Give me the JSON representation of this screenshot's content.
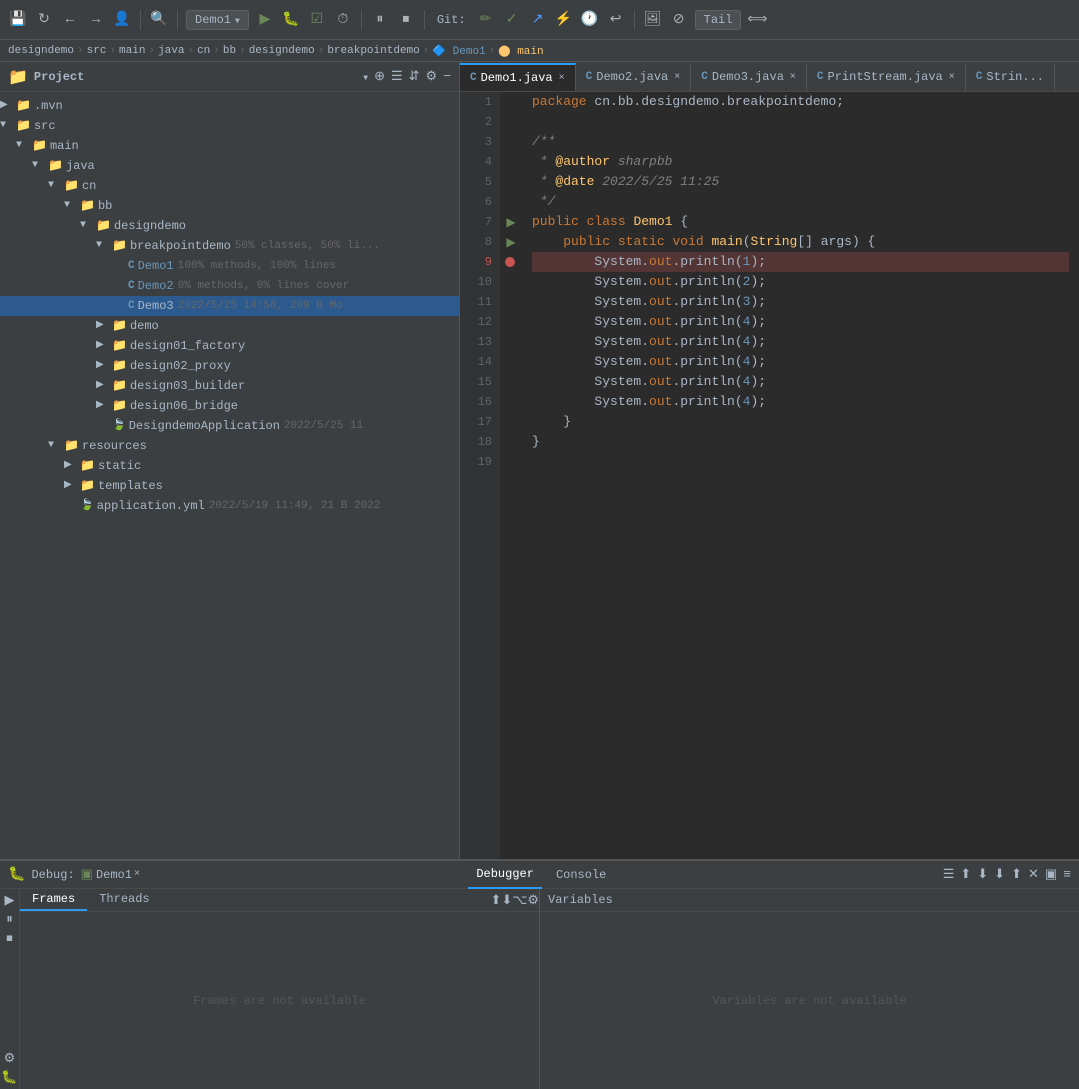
{
  "toolbar": {
    "run_config": "Demo1",
    "git_label": "Git:",
    "tail_label": "Tail",
    "translate_icon": "⟺"
  },
  "breadcrumb": {
    "items": [
      "designdemo",
      "src",
      "main",
      "java",
      "cn",
      "bb",
      "designdemo",
      "breakpointdemo",
      "Demo1",
      "main"
    ]
  },
  "project": {
    "title": "Project",
    "tree": [
      {
        "id": "mvn",
        "label": ".mvn",
        "type": "folder",
        "depth": 0,
        "open": false
      },
      {
        "id": "src",
        "label": "src",
        "type": "folder",
        "depth": 0,
        "open": true
      },
      {
        "id": "main",
        "label": "main",
        "type": "folder",
        "depth": 1,
        "open": true
      },
      {
        "id": "java",
        "label": "java",
        "type": "folder",
        "depth": 2,
        "open": true
      },
      {
        "id": "cn",
        "label": "cn",
        "type": "folder",
        "depth": 3,
        "open": true
      },
      {
        "id": "bb",
        "label": "bb",
        "type": "folder",
        "depth": 4,
        "open": true
      },
      {
        "id": "designdemo",
        "label": "designdemo",
        "type": "folder",
        "depth": 5,
        "open": true
      },
      {
        "id": "breakpointdemo",
        "label": "breakpointdemo",
        "type": "folder",
        "depth": 6,
        "open": true,
        "meta": "50% classes, 50% li..."
      },
      {
        "id": "Demo1",
        "label": "Demo1",
        "type": "java",
        "depth": 7,
        "meta": "100% methods, 100% lines"
      },
      {
        "id": "Demo2",
        "label": "Demo2",
        "type": "java",
        "depth": 7,
        "meta": "0% methods, 0% lines cover"
      },
      {
        "id": "Demo3",
        "label": "Demo3",
        "type": "java",
        "depth": 7,
        "selected": true,
        "meta": "2022/5/25 14:58, 209 B Mo"
      },
      {
        "id": "demo",
        "label": "demo",
        "type": "folder",
        "depth": 6,
        "open": false
      },
      {
        "id": "design01_factory",
        "label": "design01_factory",
        "type": "folder",
        "depth": 6,
        "open": false
      },
      {
        "id": "design02_proxy",
        "label": "design02_proxy",
        "type": "folder",
        "depth": 6,
        "open": false
      },
      {
        "id": "design03_builder",
        "label": "design03_builder",
        "type": "folder",
        "depth": 6,
        "open": false
      },
      {
        "id": "design06_bridge",
        "label": "design06_bridge",
        "type": "folder",
        "depth": 6,
        "open": false
      },
      {
        "id": "DesigndemoApplication",
        "label": "DesigndemoApplication",
        "type": "spring",
        "depth": 6,
        "meta": "2022/5/25 11"
      },
      {
        "id": "resources",
        "label": "resources",
        "type": "folder",
        "depth": 3,
        "open": true
      },
      {
        "id": "static",
        "label": "static",
        "type": "folder",
        "depth": 4,
        "open": false
      },
      {
        "id": "templates",
        "label": "templates",
        "type": "folder",
        "depth": 4,
        "open": false
      },
      {
        "id": "application_yml",
        "label": "application.yml",
        "type": "yml",
        "depth": 4,
        "meta": "2022/5/19 11:49, 21 B 2022"
      }
    ]
  },
  "editor": {
    "tabs": [
      {
        "id": "Demo1",
        "label": "Demo1.java",
        "active": true
      },
      {
        "id": "Demo2",
        "label": "Demo2.java",
        "active": false
      },
      {
        "id": "Demo3",
        "label": "Demo3.java",
        "active": false
      },
      {
        "id": "PrintStream",
        "label": "PrintStream.java",
        "active": false
      },
      {
        "id": "Strin",
        "label": "Strin...",
        "active": false
      }
    ],
    "code_lines": [
      {
        "n": 1,
        "text": "package cn.bb.designdemo.breakpointdemo;",
        "tokens": [
          {
            "t": "kw",
            "v": "package"
          },
          {
            "t": "sym",
            "v": " cn.bb.designdemo.breakpointdemo;"
          }
        ]
      },
      {
        "n": 2,
        "text": ""
      },
      {
        "n": 3,
        "text": "/**",
        "tokens": [
          {
            "t": "cm",
            "v": "/**"
          }
        ]
      },
      {
        "n": 4,
        "text": " * @author sharpbb",
        "tokens": [
          {
            "t": "cm",
            "v": " * "
          },
          {
            "t": "ann",
            "v": "@author"
          },
          {
            "t": "cm",
            "v": " sharpbb"
          }
        ]
      },
      {
        "n": 5,
        "text": " * @date 2022/5/25 11:25",
        "tokens": [
          {
            "t": "cm",
            "v": " * "
          },
          {
            "t": "ann",
            "v": "@date"
          },
          {
            "t": "cm",
            "v": " 2022/5/25 11:25"
          }
        ]
      },
      {
        "n": 6,
        "text": " */",
        "tokens": [
          {
            "t": "cm",
            "v": " */"
          }
        ]
      },
      {
        "n": 7,
        "text": "public class Demo1 {",
        "tokens": [
          {
            "t": "kw",
            "v": "public"
          },
          {
            "t": "sym",
            "v": " "
          },
          {
            "t": "kw",
            "v": "class"
          },
          {
            "t": "sym",
            "v": " "
          },
          {
            "t": "cls",
            "v": "Demo1"
          },
          {
            "t": "sym",
            "v": " {"
          }
        ],
        "run": true
      },
      {
        "n": 8,
        "text": "    public static void main(String[] args) {",
        "tokens": [
          {
            "t": "kw",
            "v": "    public"
          },
          {
            "t": "sym",
            "v": " "
          },
          {
            "t": "kw",
            "v": "static"
          },
          {
            "t": "sym",
            "v": " "
          },
          {
            "t": "kw",
            "v": "void"
          },
          {
            "t": "sym",
            "v": " "
          },
          {
            "t": "fn",
            "v": "main"
          },
          {
            "t": "sym",
            "v": "("
          },
          {
            "t": "cls",
            "v": "String"
          },
          {
            "t": "sym",
            "v": "[] args) {"
          }
        ],
        "run": true
      },
      {
        "n": 9,
        "text": "        System.out.println(1);",
        "tokens": [
          {
            "t": "sym",
            "v": "        System.out.println("
          },
          {
            "t": "num",
            "v": "1"
          },
          {
            "t": "sym",
            "v": ");"
          }
        ],
        "breakpoint": true
      },
      {
        "n": 10,
        "text": "        System.out.println(2);",
        "tokens": [
          {
            "t": "sym",
            "v": "        System.out.println("
          },
          {
            "t": "num",
            "v": "2"
          },
          {
            "t": "sym",
            "v": ");"
          }
        ]
      },
      {
        "n": 11,
        "text": "        System.out.println(3);",
        "tokens": [
          {
            "t": "sym",
            "v": "        System.out.println("
          },
          {
            "t": "num",
            "v": "3"
          },
          {
            "t": "sym",
            "v": ");"
          }
        ]
      },
      {
        "n": 12,
        "text": "        System.out.println(4);",
        "tokens": [
          {
            "t": "sym",
            "v": "        System.out.println("
          },
          {
            "t": "num",
            "v": "4"
          },
          {
            "t": "sym",
            "v": ");"
          }
        ]
      },
      {
        "n": 13,
        "text": "        System.out.println(4);",
        "tokens": [
          {
            "t": "sym",
            "v": "        System.out.println("
          },
          {
            "t": "num",
            "v": "4"
          },
          {
            "t": "sym",
            "v": ");"
          }
        ]
      },
      {
        "n": 14,
        "text": "        System.out.println(4);",
        "tokens": [
          {
            "t": "sym",
            "v": "        System.out.println("
          },
          {
            "t": "num",
            "v": "4"
          },
          {
            "t": "sym",
            "v": ");"
          }
        ]
      },
      {
        "n": 15,
        "text": "        System.out.println(4);",
        "tokens": [
          {
            "t": "sym",
            "v": "        System.out.println("
          },
          {
            "t": "num",
            "v": "4"
          },
          {
            "t": "sym",
            "v": ");"
          }
        ]
      },
      {
        "n": 16,
        "text": "        System.out.println(4);",
        "tokens": [
          {
            "t": "sym",
            "v": "        System.out.println("
          },
          {
            "t": "num",
            "v": "4"
          },
          {
            "t": "sym",
            "v": ");"
          }
        ]
      },
      {
        "n": 17,
        "text": "    }",
        "tokens": [
          {
            "t": "sym",
            "v": "    }"
          }
        ],
        "foldable": true
      },
      {
        "n": 18,
        "text": "}",
        "tokens": [
          {
            "t": "sym",
            "v": "}"
          }
        ]
      },
      {
        "n": 19,
        "text": ""
      }
    ]
  },
  "debug": {
    "tab_label": "Debug:",
    "run_config": "Demo1",
    "tabs": [
      {
        "id": "debugger",
        "label": "Debugger",
        "active": true
      },
      {
        "id": "console",
        "label": "Console",
        "active": false
      }
    ],
    "frames_tab": "Frames",
    "threads_tab": "Threads",
    "variables_header": "Variables",
    "frames_empty": "Frames are not available",
    "variables_empty": "Variables are not available"
  }
}
